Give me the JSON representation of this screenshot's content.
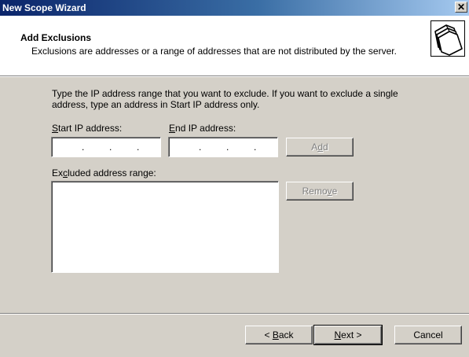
{
  "window": {
    "title": "New Scope Wizard",
    "close_glyph": "✕"
  },
  "header": {
    "title": "Add Exclusions",
    "description": "Exclusions are addresses or a range of addresses that are not distributed by the server.",
    "icon": "folders-icon"
  },
  "body": {
    "instructions": "Type the IP address range that you want to exclude. If you want to exclude a single address, type an address in Start IP address only.",
    "start_ip": {
      "label_pre": "",
      "label_accel": "S",
      "label_post": "tart IP address:",
      "value": ""
    },
    "end_ip": {
      "label_pre": "",
      "label_accel": "E",
      "label_post": "nd IP address:",
      "value": ""
    },
    "add_button": {
      "pre": "A",
      "accel": "d",
      "post": "d",
      "enabled": false
    },
    "excluded_range": {
      "label_pre": "Ex",
      "label_accel": "c",
      "label_post": "luded address range:",
      "items": []
    },
    "remove_button": {
      "pre": "Remo",
      "accel": "v",
      "post": "e",
      "enabled": false
    }
  },
  "footer": {
    "back_button": {
      "pre": "< ",
      "accel": "B",
      "post": "ack"
    },
    "next_button": {
      "pre": "",
      "accel": "N",
      "post": "ext >"
    },
    "cancel_button": {
      "label": "Cancel"
    }
  },
  "colors": {
    "dialog_bg": "#d4d0c8",
    "title_gradient_start": "#0a246a",
    "title_gradient_end": "#a6caf0",
    "header_bg": "#ffffff",
    "disabled_text": "#808080"
  }
}
